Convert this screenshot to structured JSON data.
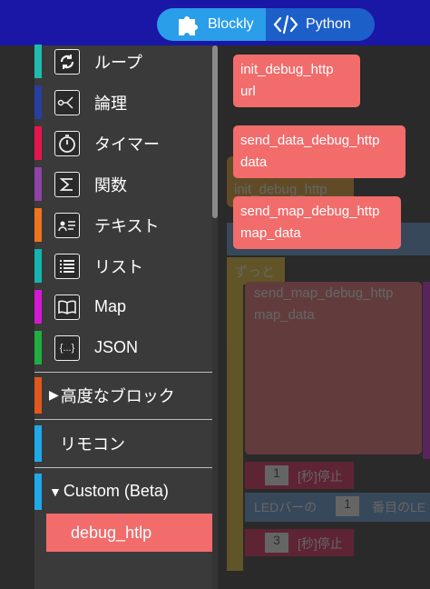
{
  "header": {
    "toggle": {
      "blockly_label": "Blockly",
      "python_label": "Python"
    }
  },
  "toolbox": {
    "categories": [
      {
        "label": "ループ",
        "color": "#1fbcae",
        "icon": "loop-icon"
      },
      {
        "label": "論理",
        "color": "#283ea0",
        "icon": "logic-icon"
      },
      {
        "label": "タイマー",
        "color": "#e6154e",
        "icon": "timer-icon"
      },
      {
        "label": "関数",
        "color": "#8f43a6",
        "icon": "sigma-icon"
      },
      {
        "label": "テキスト",
        "color": "#f0731e",
        "icon": "text-icon"
      },
      {
        "label": "リスト",
        "color": "#14b4b0",
        "icon": "list-icon"
      },
      {
        "label": "Map",
        "color": "#d418d4",
        "icon": "map-book-icon"
      },
      {
        "label": "JSON",
        "color": "#1fae3f",
        "icon": "json-icon"
      }
    ],
    "advanced": {
      "label": "高度なブロック",
      "color": "#e1571c"
    },
    "remote": {
      "label": "リモコン",
      "color": "#1fa9ea"
    },
    "custom": {
      "label": "Custom (Beta)",
      "color": "#1fa9ea"
    },
    "custom_item": "debug_htlp"
  },
  "flyout": {
    "blocks": [
      {
        "line1": "init_debug_http",
        "line2": "url"
      },
      {
        "line1": "send_data_debug_http",
        "line2": "data"
      },
      {
        "line1": "send_map_debug_http",
        "line2": "map_data"
      }
    ]
  },
  "workspace_ghost": {
    "labels": {
      "init": "init_debug_http",
      "forever": "ずっと",
      "send_map": "send_map_debug_http",
      "map_data": "map_data",
      "one": "1",
      "wait1": "[秒]停止",
      "ledbar": "LEDバーの",
      "ledbar_one": "1",
      "ledbar_rest": "番目のLE",
      "three": "3",
      "wait2": "[秒]停止"
    }
  },
  "colors": {
    "header_bg": "#1a17a6",
    "toggle_active": "#2a9ee8",
    "toggle_inactive": "#1d5fc8",
    "custom_block": "#f26c6c"
  }
}
